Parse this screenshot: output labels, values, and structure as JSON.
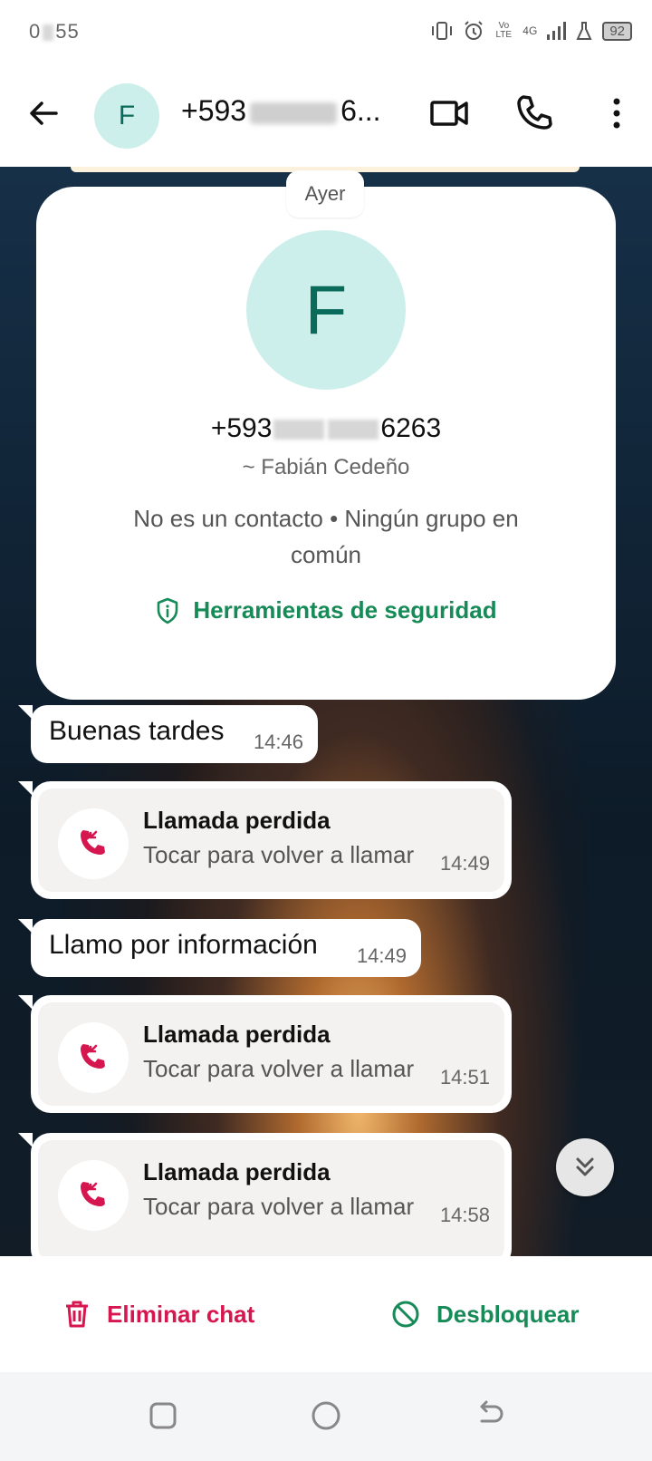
{
  "status_bar": {
    "time_prefix": "0",
    "time_suffix": "55",
    "battery": "92",
    "network": "4G",
    "volte": "Vo LTE"
  },
  "header": {
    "avatar_letter": "F",
    "title_prefix": "+593",
    "title_suffix": "6..."
  },
  "chat": {
    "date_chip": "Ayer",
    "profile": {
      "avatar_letter": "F",
      "phone_prefix": "+593",
      "phone_suffix": "6263",
      "name": "~ Fabián Cedeño",
      "info": "No es un contacto • Ningún grupo en común",
      "security_link": "Herramientas de seguridad"
    },
    "messages": [
      {
        "type": "text",
        "text": "Buenas tardes",
        "time": "14:46"
      },
      {
        "type": "call",
        "title": "Llamada perdida",
        "subtitle": "Tocar para volver a llamar",
        "time": "14:49"
      },
      {
        "type": "text",
        "text": "Llamo por información",
        "time": "14:49"
      },
      {
        "type": "call",
        "title": "Llamada perdida",
        "subtitle": "Tocar para volver a llamar",
        "time": "14:51"
      },
      {
        "type": "call",
        "title": "Llamada perdida",
        "subtitle": "Tocar para volver a llamar",
        "time": "14:58"
      }
    ]
  },
  "actions": {
    "delete_label": "Eliminar chat",
    "unblock_label": "Desbloquear"
  },
  "colors": {
    "accent_green": "#168a57",
    "danger_red": "#d6174f",
    "avatar_bg": "#cdefeb",
    "avatar_fg": "#0a6b5b"
  }
}
